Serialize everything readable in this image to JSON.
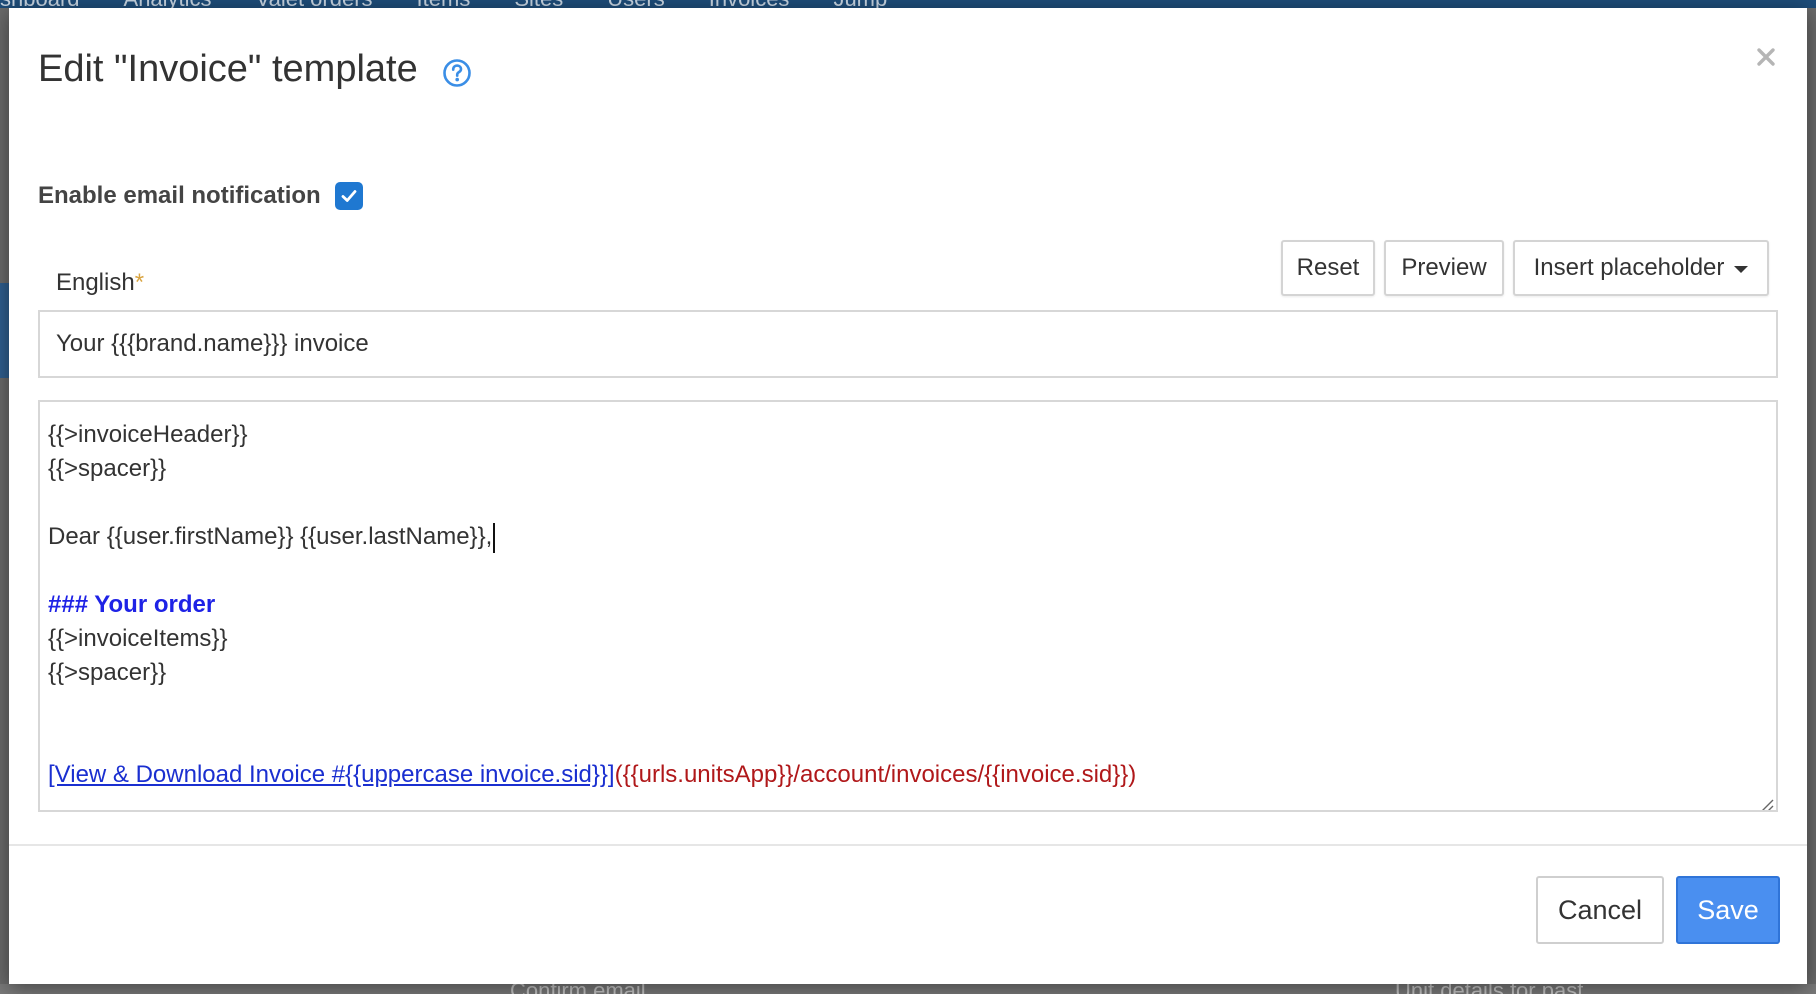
{
  "background": {
    "nav_items": [
      "shboard",
      "Analytics",
      "Valet orders",
      "Items",
      "Sites",
      "Users",
      "Invoices",
      "Jump"
    ],
    "bottom_fragments": [
      "Confirm email",
      "Unit details for past"
    ]
  },
  "modal": {
    "title": "Edit \"Invoice\" template",
    "help_icon": "question-circle-icon",
    "close_icon": "close-icon",
    "close_glyph": "×"
  },
  "notification": {
    "label": "Enable email notification",
    "checked": true
  },
  "tabs": [
    {
      "label": "English",
      "required_marker": "*",
      "active": true
    }
  ],
  "toolbar": {
    "reset_label": "Reset",
    "preview_label": "Preview",
    "insert_placeholder_label": "Insert placeholder"
  },
  "subject": {
    "value": "Your {{{brand.name}}} invoice"
  },
  "body": {
    "lines": [
      "{{>invoiceHeader}}",
      "{{>spacer}}",
      "",
      "Dear {{user.firstName}} {{user.lastName}},",
      "",
      "### Your order",
      "{{>invoiceItems}}",
      "{{>spacer}}",
      "",
      ""
    ],
    "link_text": "[View & Download Invoice #{{uppercase invoice.sid}}]",
    "link_url": "({{urls.unitsApp}}/account/invoices/{{invoice.sid}})"
  },
  "footer": {
    "cancel_label": "Cancel",
    "save_label": "Save"
  },
  "colors": {
    "accent": "#4a90e2",
    "primary_button": "#4a8ff0",
    "heading_markdown": "#1e22e6",
    "link_markdown": "#1a2fd0",
    "url_markdown": "#b0181a",
    "required_marker": "#d9a441"
  }
}
